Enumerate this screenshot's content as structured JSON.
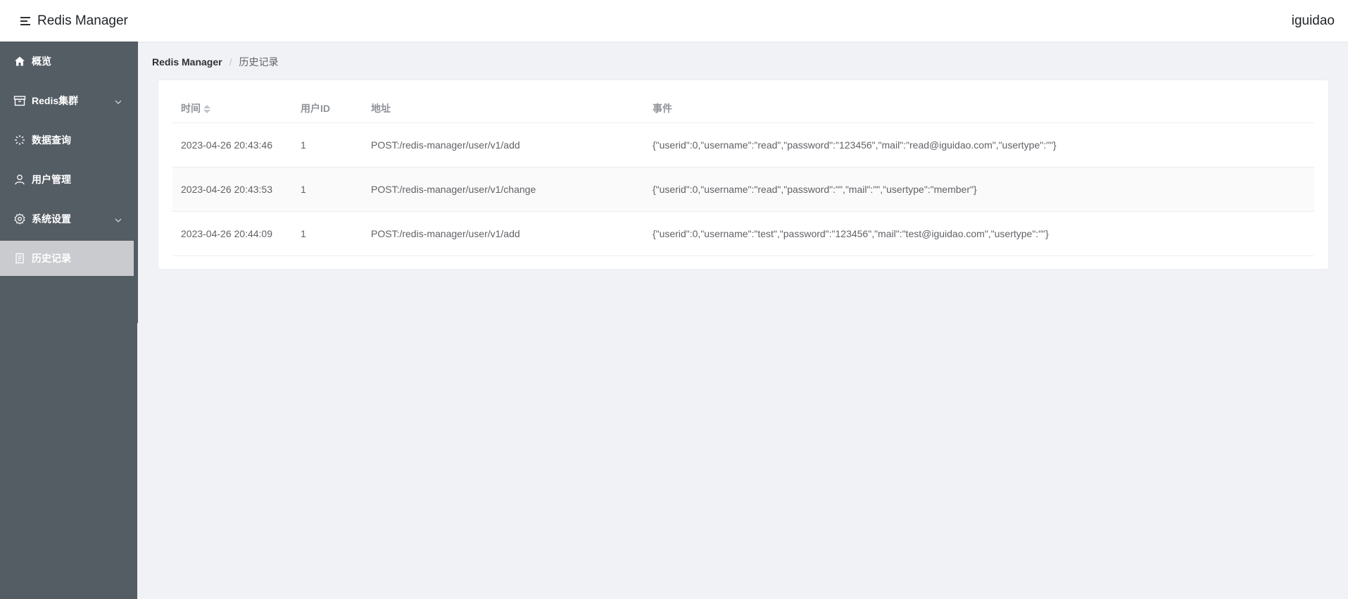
{
  "header": {
    "app_title": "Redis Manager",
    "user_name": "iguidao"
  },
  "sidebar": {
    "items": [
      {
        "label": "概览",
        "icon": "home-icon",
        "has_submenu": false,
        "active": false
      },
      {
        "label": "Redis集群",
        "icon": "box-icon",
        "has_submenu": true,
        "active": false
      },
      {
        "label": "数据查询",
        "icon": "loading-icon",
        "has_submenu": false,
        "active": false
      },
      {
        "label": "用户管理",
        "icon": "user-icon",
        "has_submenu": false,
        "active": false
      },
      {
        "label": "系统设置",
        "icon": "gear-icon",
        "has_submenu": true,
        "active": false
      },
      {
        "label": "历史记录",
        "icon": "document-icon",
        "has_submenu": false,
        "active": true
      }
    ]
  },
  "breadcrumb": {
    "root": "Redis Manager",
    "separator": "/",
    "current": "历史记录"
  },
  "table": {
    "columns": [
      "时间",
      "用户ID",
      "地址",
      "事件"
    ],
    "rows": [
      {
        "time": "2023-04-26 20:43:46",
        "user_id": "1",
        "address": "POST:/redis-manager/user/v1/add",
        "event": "{\"userid\":0,\"username\":\"read\",\"password\":\"123456\",\"mail\":\"read@iguidao.com\",\"usertype\":\"\"}"
      },
      {
        "time": "2023-04-26 20:43:53",
        "user_id": "1",
        "address": "POST:/redis-manager/user/v1/change",
        "event": "{\"userid\":0,\"username\":\"read\",\"password\":\"\",\"mail\":\"\",\"usertype\":\"member\"}"
      },
      {
        "time": "2023-04-26 20:44:09",
        "user_id": "1",
        "address": "POST:/redis-manager/user/v1/add",
        "event": "{\"userid\":0,\"username\":\"test\",\"password\":\"123456\",\"mail\":\"test@iguidao.com\",\"usertype\":\"\"}"
      }
    ]
  },
  "colors": {
    "sidebar_bg": "#545c64",
    "sidebar_active_bg": "#c9cbce",
    "page_bg": "#f0f2f5"
  }
}
